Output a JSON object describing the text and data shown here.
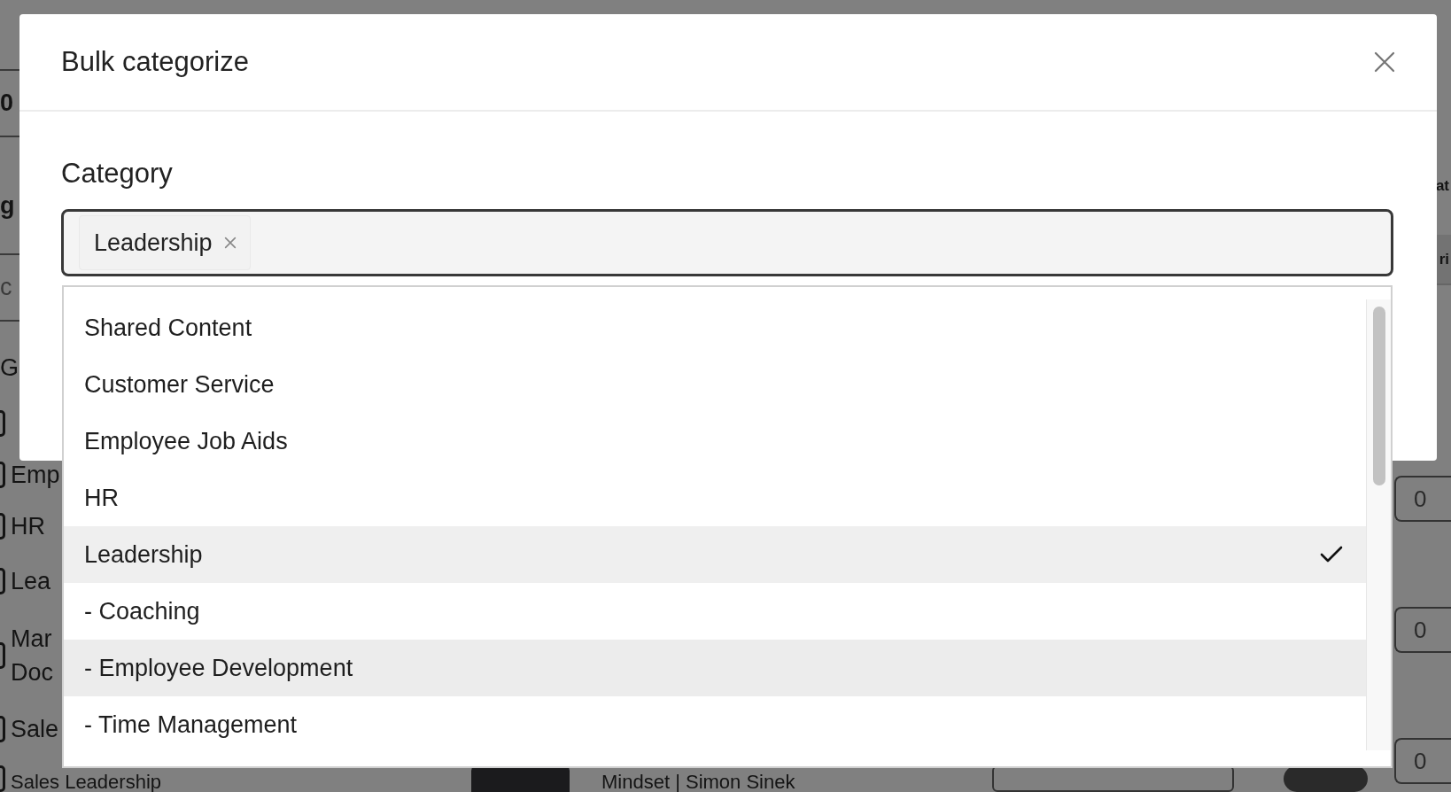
{
  "background": {
    "left_items": [
      {
        "kind": "heading",
        "text": "0"
      },
      {
        "kind": "heading",
        "text": "g"
      },
      {
        "kind": "hint",
        "text": "c"
      },
      {
        "kind": "text",
        "text": "G"
      },
      {
        "kind": "checkbox",
        "checked": false
      },
      {
        "kind": "checkbox",
        "lines": [
          "Emp"
        ],
        "checked": false
      },
      {
        "kind": "checkbox",
        "lines": [
          "HR"
        ],
        "checked": false
      },
      {
        "kind": "checkbox",
        "lines": [
          "Lea"
        ],
        "checked": false
      },
      {
        "kind": "checkbox",
        "lines": [
          "Mar",
          "Doc"
        ],
        "checked": false
      },
      {
        "kind": "checkbox",
        "lines": [
          "Sale"
        ],
        "checked": false
      },
      {
        "kind": "checkbox",
        "lines": [
          "Sales Leadership"
        ],
        "checked": false
      }
    ],
    "right_items": [
      {
        "kind": "heading",
        "text": "at"
      },
      {
        "kind": "header",
        "text": "ri"
      },
      {
        "kind": "count",
        "text": "0"
      },
      {
        "kind": "count",
        "text": "0"
      },
      {
        "kind": "count",
        "text": "0"
      }
    ],
    "bottom_row": {
      "title": "Mindset | Simon Sinek"
    }
  },
  "modal": {
    "title": "Bulk categorize",
    "field_label": "Category",
    "tags": [
      {
        "label": "Leadership"
      }
    ],
    "options": [
      {
        "label": "Shared Content",
        "selected": false,
        "hovered": false
      },
      {
        "label": "Customer Service",
        "selected": false,
        "hovered": false
      },
      {
        "label": "Employee Job Aids",
        "selected": false,
        "hovered": false
      },
      {
        "label": "HR",
        "selected": false,
        "hovered": false
      },
      {
        "label": "Leadership",
        "selected": true,
        "hovered": false
      },
      {
        "label": "- Coaching",
        "selected": false,
        "hovered": false
      },
      {
        "label": "- Employee Development",
        "selected": false,
        "hovered": true
      },
      {
        "label": "- Time Management",
        "selected": false,
        "hovered": false
      }
    ]
  }
}
